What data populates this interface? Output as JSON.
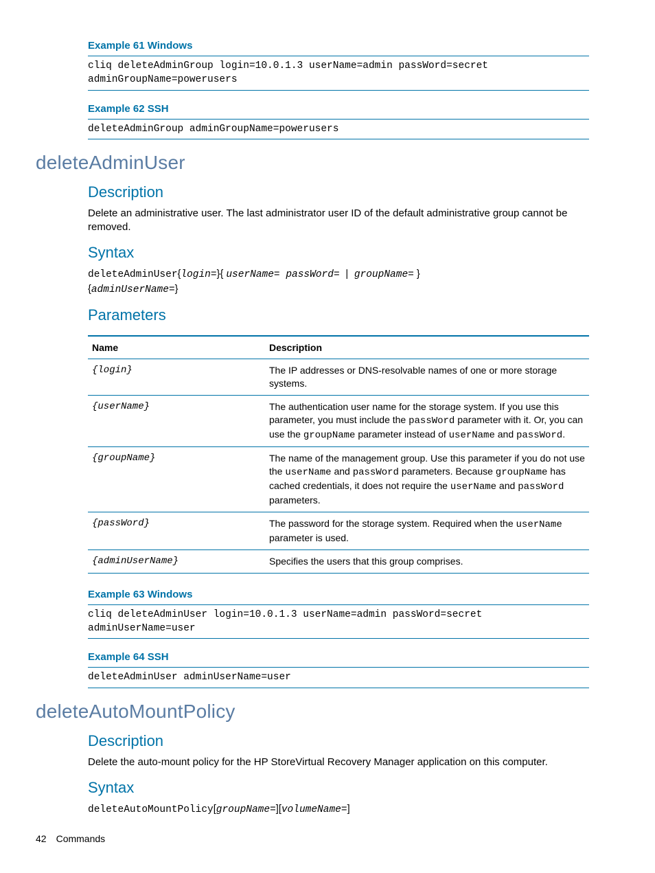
{
  "ex61": {
    "title": "Example 61 Windows",
    "code": "cliq deleteAdminGroup login=10.0.1.3 userName=admin passWord=secret adminGroupName=powerusers"
  },
  "ex62": {
    "title": "Example 62 SSH",
    "code": "deleteAdminGroup adminGroupName=powerusers"
  },
  "sec1": {
    "title": "deleteAdminUser",
    "desc_h": "Description",
    "desc": "Delete an administrative user. The last administrator user ID of the default administrative group cannot be removed.",
    "syntax_h": "Syntax",
    "params_h": "Parameters"
  },
  "table": {
    "h_name": "Name",
    "h_desc": "Description",
    "rows": [
      {
        "name": "{login}",
        "d_pre": "The IP addresses or DNS-resolvable names of one or more storage systems."
      },
      {
        "name": "{userName}"
      },
      {
        "name": "{groupName}"
      },
      {
        "name": "{passWord}"
      },
      {
        "name": "{adminUserName}",
        "d_pre": "Specifies the users that this group comprises."
      }
    ],
    "t": {
      "r1a": "The authentication user name for the storage system. If you use this parameter, you must include the ",
      "r1b": "passWord",
      "r1c": " parameter with it. Or, you can use the ",
      "r1d": "groupName",
      "r1e": " parameter instead of ",
      "r1f": "userName",
      "r1g": " and ",
      "r1h": "passWord",
      "r1i": ".",
      "r2a": "The name of the management group. Use this parameter if you do not use the ",
      "r2b": "userName",
      "r2c": " and ",
      "r2d": "passWord",
      "r2e": " parameters. Because ",
      "r2f": "groupName",
      "r2g": " has cached credentials, it does not require the ",
      "r2h": "userName",
      "r2i": " and ",
      "r2j": "passWord",
      "r2k": " parameters.",
      "r3a": "The password for the storage system. Required when the ",
      "r3b": "userName",
      "r3c": " parameter is used."
    }
  },
  "syn1": {
    "cmd": "deleteAdminUser",
    "lb1": "{",
    "p1": "login=",
    "rb1": "}",
    "lb2": "{ ",
    "p2": "userName= passWord= ",
    "pipe": "|",
    "p3": " groupName=",
    "rb2": " }",
    "lb3": "{",
    "p4": "adminUserName=",
    "rb3": "}"
  },
  "ex63": {
    "title": "Example 63 Windows",
    "code": "cliq deleteAdminUser login=10.0.1.3 userName=admin passWord=secret adminUserName=user"
  },
  "ex64": {
    "title": "Example 64 SSH",
    "code": "deleteAdminUser adminUserName=user"
  },
  "sec2": {
    "title": "deleteAutoMountPolicy",
    "desc_h": "Description",
    "desc": "Delete the auto-mount policy for the HP StoreVirtual Recovery Manager application on this computer.",
    "syntax_h": "Syntax"
  },
  "syn2": {
    "cmd": "deleteAutoMountPolicy",
    "lb1": "[",
    "p1": "groupName=",
    "rb1": "]",
    "lb2": "[",
    "p2": "volumeName=",
    "rb2": "]"
  },
  "footer": {
    "page": "42",
    "label": "Commands"
  }
}
